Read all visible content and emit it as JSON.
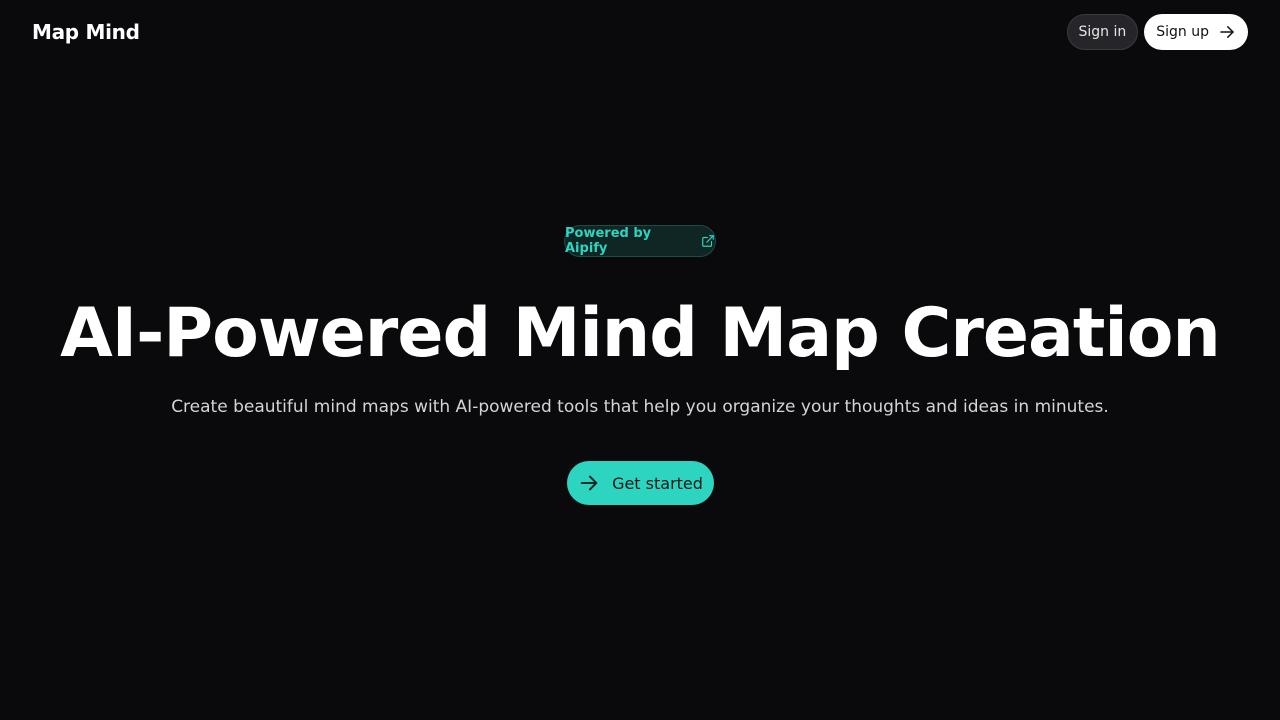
{
  "header": {
    "logo": "Map Mind",
    "sign_in_label": "Sign in",
    "sign_up_label": "Sign up"
  },
  "hero": {
    "badge_label": "Powered by Aipify",
    "title": "AI-Powered Mind Map Creation",
    "subtitle": "Create beautiful mind maps with AI-powered tools that help you organize your thoughts and ideas in minutes.",
    "cta_label": "Get started"
  },
  "icons": {
    "sign_up_icon": "arrow-right-icon",
    "badge_icon": "external-link-icon",
    "cta_icon": "arrow-right-icon"
  },
  "colors": {
    "background": "#0a0a0c",
    "accent": "#2dd4bf",
    "text": "#ffffff",
    "muted_text": "#d4d4d8"
  }
}
